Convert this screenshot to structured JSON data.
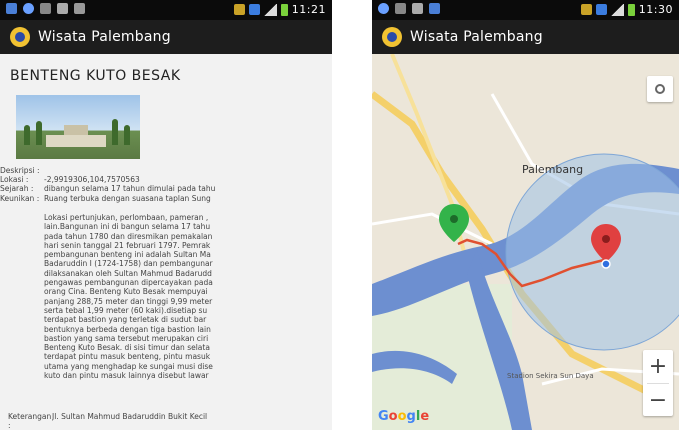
{
  "left": {
    "status_time": "11:21",
    "app_title": "Wisata Palembang",
    "place_title": "BENTENG KUTO BESAK",
    "fields": [
      {
        "label": "Deskripsi :",
        "value": ""
      },
      {
        "label": "Lokasi :",
        "value": "-2,9919306,104,7570563"
      },
      {
        "label": "Sejarah :",
        "value": "dibangun selama 17 tahun dimulai pada tahu"
      },
      {
        "label": "Keunikan :",
        "value": "Ruang terbuka dengan suasana taplan Sung"
      }
    ],
    "description_lines": [
      "Lokasi pertunjukan, perlombaan, pameran ,",
      "lain.Bangunan ini di bangun selama 17 tahu",
      "pada tahun 1780 dan diresmikan pemakalan",
      "hari senin tanggal 21 februari 1797. Pemrak",
      "pembangunan benteng ini adalah Sultan Ma",
      "Badaruddin I (1724-1758) dan pembangunar",
      "dilaksanakan oleh Sultan Mahmud Badarudd",
      "pengawas pembangunan dipercayakan pada",
      "orang Cina. Benteng Kuto Besak mempuyai",
      "panjang 288,75 meter dan tinggi 9,99 meter",
      "serta tebal 1,99 meter (60 kaki).disetiap su",
      "terdapat bastion yang terletak di sudut bar",
      "bentuknya berbeda dengan tiga bastion lain",
      "bastion yang sama tersebut merupakan ciri",
      "Benteng Kuto Besak. di sisi timur dan selata",
      "terdapat pintu masuk benteng, pintu masuk",
      "utama yang menghadap ke sungai musi dise",
      "kuto dan pintu masuk lainnya disebut lawar"
    ],
    "keterangan_label": "Keterangan :",
    "keterangan_value": "Jl. Sultan Mahmud Badaruddin Bukit Kecil"
  },
  "right": {
    "status_time": "11:30",
    "app_title": "Wisata Palembang",
    "city_label": "Palembang",
    "stadium_label": "Stadion Sekira Sun Daya",
    "zoom_in": "+",
    "zoom_out": "−",
    "google": [
      "G",
      "o",
      "o",
      "g",
      "l",
      "e"
    ]
  },
  "colors": {
    "status_bar": "#0b0b0b",
    "action_bar": "#1d1d1d",
    "river": "#6d8fd0",
    "route": "#e05030",
    "marker_origin": "#33b34a",
    "marker_dest": "#e04040",
    "accuracy_circle": "#9ec1e6"
  }
}
